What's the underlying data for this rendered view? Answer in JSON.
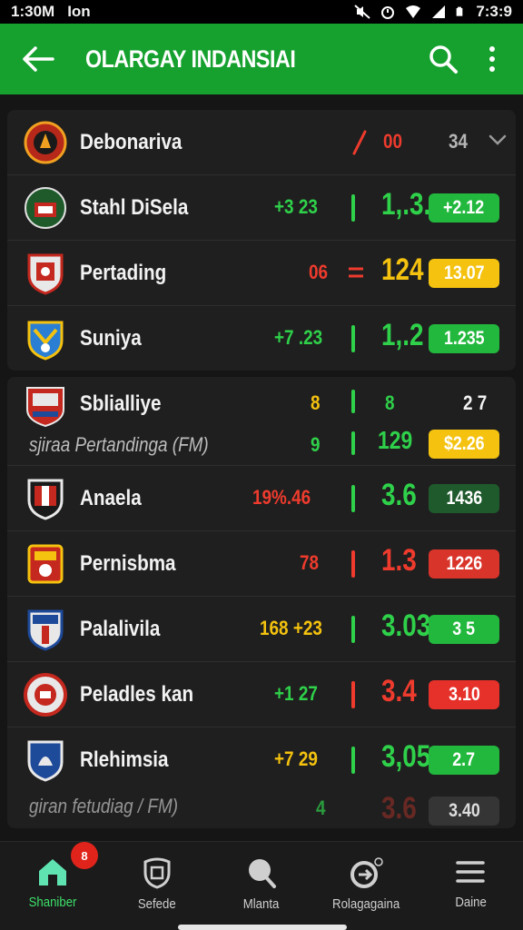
{
  "status_bar": {
    "time": "1:30M",
    "carrier": "Ion",
    "clock": "7:3:9"
  },
  "app_bar": {
    "title": "OLARGAY INDANSIAI"
  },
  "colors": {
    "brand_green": "#16a12f",
    "up_green": "#2fd14a",
    "down_red": "#ef3b2d",
    "neutral_yellow": "#f4c20f"
  },
  "card1": {
    "rows": [
      {
        "team": "Debonariva",
        "score": "00",
        "right": "34"
      },
      {
        "team": "Stahl DiSela",
        "score": "+3  23",
        "odds": "1,.3.",
        "pill": "+2.12"
      },
      {
        "team": "Pertading",
        "score": "06",
        "odds": "124",
        "pill": "13.07"
      },
      {
        "team": "Suniya",
        "score": "+7 .23",
        "odds": "1,.2",
        "pill": "1.235"
      }
    ]
  },
  "card2": {
    "rows": [
      {
        "team": "Sblialliye",
        "score": "8",
        "odds": "8",
        "right": "2 7"
      },
      {
        "subtitle": "sjiraa Pertandinga (FM)",
        "score": "9",
        "odds": "129",
        "pill": "$2.26"
      },
      {
        "team": "Anaela",
        "score": "19%.46",
        "odds": "3.6",
        "pill": "1436"
      },
      {
        "team": "Pernisbma",
        "score": "78",
        "odds": "1.3",
        "pill": "1226"
      },
      {
        "team": "Palalivila",
        "score": "168 +23",
        "odds": "3.03",
        "pill": "3 5"
      },
      {
        "team": "Peladles kan",
        "score": "+1  27",
        "odds": "3.4",
        "pill": "3.10"
      },
      {
        "team": "Rlehimsia",
        "score": "+7  29",
        "odds": "3,05",
        "pill": "2.7"
      },
      {
        "subtitle": "giran fetudiag / FM)",
        "score": "4",
        "odds": "3.6",
        "pill": "3.40"
      }
    ]
  },
  "bottom_nav": {
    "items": [
      {
        "label": "Shaniber",
        "icon": "home-icon",
        "badge": "8"
      },
      {
        "label": "Sefede",
        "icon": "shield-icon"
      },
      {
        "label": "Mlanta",
        "icon": "search-pin-icon"
      },
      {
        "label": "Rolagagaina",
        "icon": "sync-icon"
      },
      {
        "label": "Daine",
        "icon": "menu-icon"
      }
    ]
  }
}
